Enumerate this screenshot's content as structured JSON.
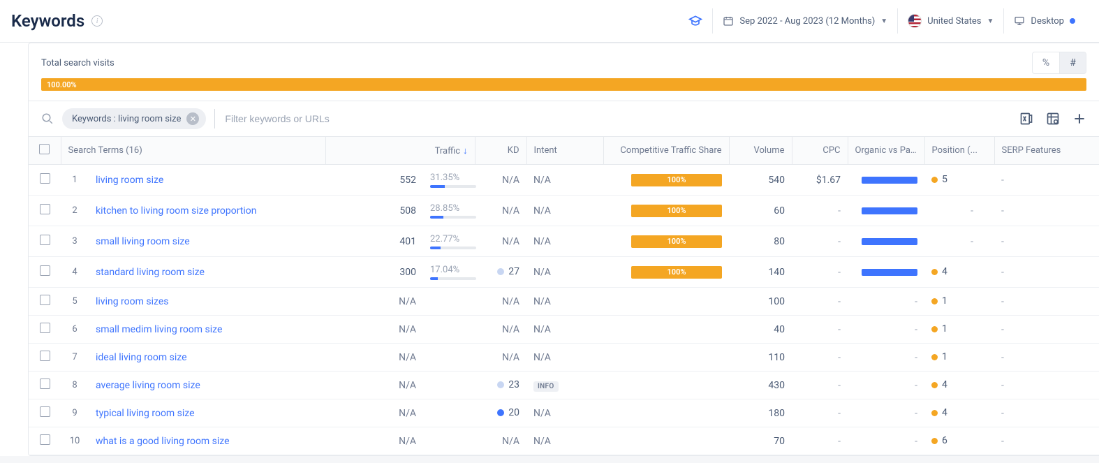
{
  "header": {
    "title": "Keywords",
    "date_range": "Sep 2022 - Aug 2023 (12 Months)",
    "country": "United States",
    "device": "Desktop"
  },
  "visits": {
    "label": "Total search visits",
    "percent": "100.00%",
    "toggle_pct": "%",
    "toggle_num": "#"
  },
  "filter": {
    "chip_label": "Keywords : living room size",
    "placeholder": "Filter keywords or URLs"
  },
  "columns": {
    "search_terms": "Search Terms (16)",
    "traffic": "Traffic",
    "kd": "KD",
    "intent": "Intent",
    "cts": "Competitive Traffic Share",
    "volume": "Volume",
    "cpc": "CPC",
    "ovp": "Organic vs Paid",
    "position": "Position (...",
    "serp": "SERP Features"
  },
  "rows": [
    {
      "n": "1",
      "term": "living room size",
      "traffic": "552",
      "traffic_pct": "31.35%",
      "traffic_bar": 31.35,
      "kd": "N/A",
      "kd_dot": "",
      "intent": "N/A",
      "cts": "100%",
      "cts_color": "#f4a623",
      "vol": "540",
      "cpc": "$1.67",
      "ovp": 100,
      "pos": "5",
      "serp": "-"
    },
    {
      "n": "2",
      "term": "kitchen to living room size proportion",
      "traffic": "508",
      "traffic_pct": "28.85%",
      "traffic_bar": 28.85,
      "kd": "N/A",
      "kd_dot": "",
      "intent": "N/A",
      "cts": "100%",
      "cts_color": "#f4a623",
      "vol": "60",
      "cpc": "-",
      "ovp": 100,
      "pos": "-",
      "serp": "-"
    },
    {
      "n": "3",
      "term": "small living room size",
      "traffic": "401",
      "traffic_pct": "22.77%",
      "traffic_bar": 22.77,
      "kd": "N/A",
      "kd_dot": "",
      "intent": "N/A",
      "cts": "100%",
      "cts_color": "#f4a623",
      "vol": "80",
      "cpc": "-",
      "ovp": 100,
      "pos": "-",
      "serp": "-"
    },
    {
      "n": "4",
      "term": "standard living room size",
      "traffic": "300",
      "traffic_pct": "17.04%",
      "traffic_bar": 17.04,
      "kd": "27",
      "kd_dot": "light",
      "intent": "N/A",
      "cts": "100%",
      "cts_color": "#f4a623",
      "vol": "140",
      "cpc": "-",
      "ovp": 100,
      "pos": "4",
      "serp": "-"
    },
    {
      "n": "5",
      "term": "living room sizes",
      "traffic": "N/A",
      "traffic_pct": "",
      "traffic_bar": 0,
      "kd": "N/A",
      "kd_dot": "",
      "intent": "N/A",
      "cts": "",
      "cts_color": "",
      "vol": "100",
      "cpc": "-",
      "ovp": 0,
      "pos": "1",
      "serp": "-"
    },
    {
      "n": "6",
      "term": "small medim living room size",
      "traffic": "N/A",
      "traffic_pct": "",
      "traffic_bar": 0,
      "kd": "N/A",
      "kd_dot": "",
      "intent": "N/A",
      "cts": "",
      "cts_color": "",
      "vol": "40",
      "cpc": "-",
      "ovp": 0,
      "pos": "1",
      "serp": "-"
    },
    {
      "n": "7",
      "term": "ideal living room size",
      "traffic": "N/A",
      "traffic_pct": "",
      "traffic_bar": 0,
      "kd": "N/A",
      "kd_dot": "",
      "intent": "N/A",
      "cts": "",
      "cts_color": "",
      "vol": "110",
      "cpc": "-",
      "ovp": 0,
      "pos": "1",
      "serp": "-"
    },
    {
      "n": "8",
      "term": "average living room size",
      "traffic": "N/A",
      "traffic_pct": "",
      "traffic_bar": 0,
      "kd": "23",
      "kd_dot": "light",
      "intent": "INFO",
      "cts": "",
      "cts_color": "",
      "vol": "430",
      "cpc": "-",
      "ovp": 0,
      "pos": "4",
      "serp": "-"
    },
    {
      "n": "9",
      "term": "typical living room size",
      "traffic": "N/A",
      "traffic_pct": "",
      "traffic_bar": 0,
      "kd": "20",
      "kd_dot": "dark",
      "intent": "N/A",
      "cts": "",
      "cts_color": "",
      "vol": "180",
      "cpc": "-",
      "ovp": 0,
      "pos": "4",
      "serp": "-"
    },
    {
      "n": "10",
      "term": "what is a good living room size",
      "traffic": "N/A",
      "traffic_pct": "",
      "traffic_bar": 0,
      "kd": "N/A",
      "kd_dot": "",
      "intent": "N/A",
      "cts": "",
      "cts_color": "",
      "vol": "70",
      "cpc": "-",
      "ovp": 0,
      "pos": "6",
      "serp": "-"
    }
  ]
}
